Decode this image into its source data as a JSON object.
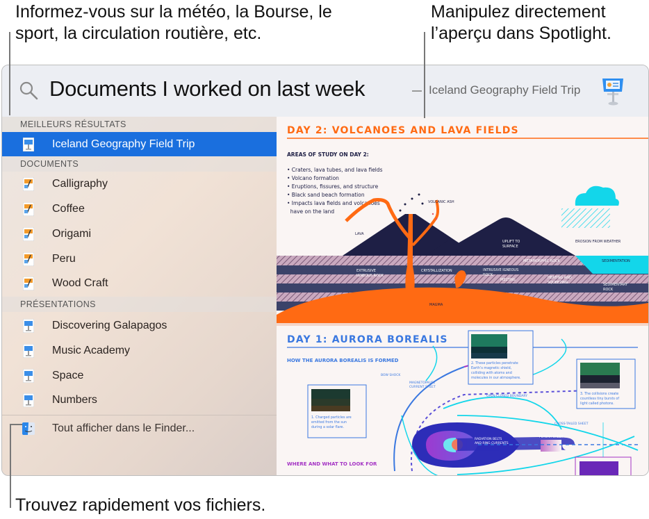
{
  "callouts": {
    "top_left": [
      "Informez-vous sur la météo, la Bourse, le",
      "sport, la circulation routière, etc."
    ],
    "top_right": [
      "Manipulez directement",
      "l’aperçu dans Spotlight."
    ],
    "bottom": "Trouvez rapidement vos fichiers."
  },
  "search": {
    "query": "Documents I worked on last week",
    "icon": "search-icon",
    "preview_title": "Iceland Geography Field Trip",
    "preview_app_icon": "keynote-icon"
  },
  "sidebar": {
    "sections": [
      {
        "header": "MEILLEURS RÉSULTATS",
        "items": [
          {
            "label": "Iceland Geography Field Trip",
            "icon": "keynote-icon",
            "selected": true
          }
        ]
      },
      {
        "header": "DOCUMENTS",
        "items": [
          {
            "label": "Calligraphy",
            "icon": "pages-icon"
          },
          {
            "label": "Coffee",
            "icon": "pages-icon"
          },
          {
            "label": "Origami",
            "icon": "pages-icon"
          },
          {
            "label": "Peru",
            "icon": "pages-icon"
          },
          {
            "label": "Wood Craft",
            "icon": "pages-icon"
          }
        ]
      },
      {
        "header": "PRÉSENTATIONS",
        "items": [
          {
            "label": "Discovering Galapagos",
            "icon": "keynote-icon"
          },
          {
            "label": "Music Academy",
            "icon": "keynote-icon"
          },
          {
            "label": "Space",
            "icon": "keynote-icon"
          },
          {
            "label": "Numbers",
            "icon": "keynote-icon"
          }
        ]
      }
    ],
    "show_all": {
      "label": "Tout afficher dans le Finder...",
      "icon": "finder-icon"
    }
  },
  "preview": {
    "day2": {
      "title": "DAY 2: VOLCANOES AND LAVA FIELDS",
      "subtitle": "AREAS OF STUDY ON DAY 2:",
      "bullets": [
        "• Craters, lava tubes, and lava fields",
        "• Volcano formation",
        "• Eruptions, fissures, and structure",
        "• Black sand beach formation",
        "• Impacts lava fields and volcanoes",
        "  have on the land"
      ],
      "labels": {
        "volcanic_ash": "VOLCANIC ASH",
        "lava": "LAVA",
        "extrusive": [
          "EXTRUSIVE",
          "IGNEOUS ROCK"
        ],
        "crystallization": "CRYSTALLIZATION",
        "magma": "MAGMA",
        "uplift": [
          "UPLIFT TO",
          "SURFACE"
        ],
        "metamorphic": "METAMORPHIC ROCK",
        "intrusive": [
          "INTRUSIVE IGNEOUS",
          "ROCK"
        ],
        "melting": "MELTING",
        "heating": [
          "HEATING AND",
          "SQUEEZING"
        ],
        "erosion": "EROSION FROM WEATHER",
        "sedimentation": "SEDIMENTATION",
        "sedimentary": [
          "SEDIMENTARY",
          "ROCK"
        ]
      }
    },
    "day1": {
      "title": "DAY 1: AURORA BOREALIS",
      "subtitle": "HOW THE AURORA BOREALIS IS FORMED",
      "where": "WHERE AND WHAT TO LOOK FOR",
      "labels": {
        "bow_shock": "BOW SHOCK",
        "magnetopause": [
          "MAGNETOPAUSE",
          "CURRENT SHEET"
        ],
        "open_closed": "OPEN-CLOSED BOUNDARY",
        "radiation": [
          "RADIATION BELTS",
          "AND RING CURRENTS"
        ],
        "cross_tailed": "CROSS-TAILED SHEET",
        "plasma": "PLASMA SHEET"
      },
      "cards": [
        [
          "1. Charged particles are",
          "emitted from the sun",
          "during a solar flare."
        ],
        [
          "2. These particles penetrate",
          "Earth’s magnetic shield,",
          "colliding with atoms and",
          "molecules in our atmosphere."
        ],
        [
          "3. The collisions create",
          "countless tiny bursts of",
          "light called photons."
        ]
      ]
    }
  },
  "colors": {
    "selection": "#1a6fde",
    "orange": "#ff6a13",
    "navy": "#1e1f45",
    "aurora_blue": "#3a78e0",
    "cyan": "#13d6ea",
    "purple": "#a433c4"
  }
}
